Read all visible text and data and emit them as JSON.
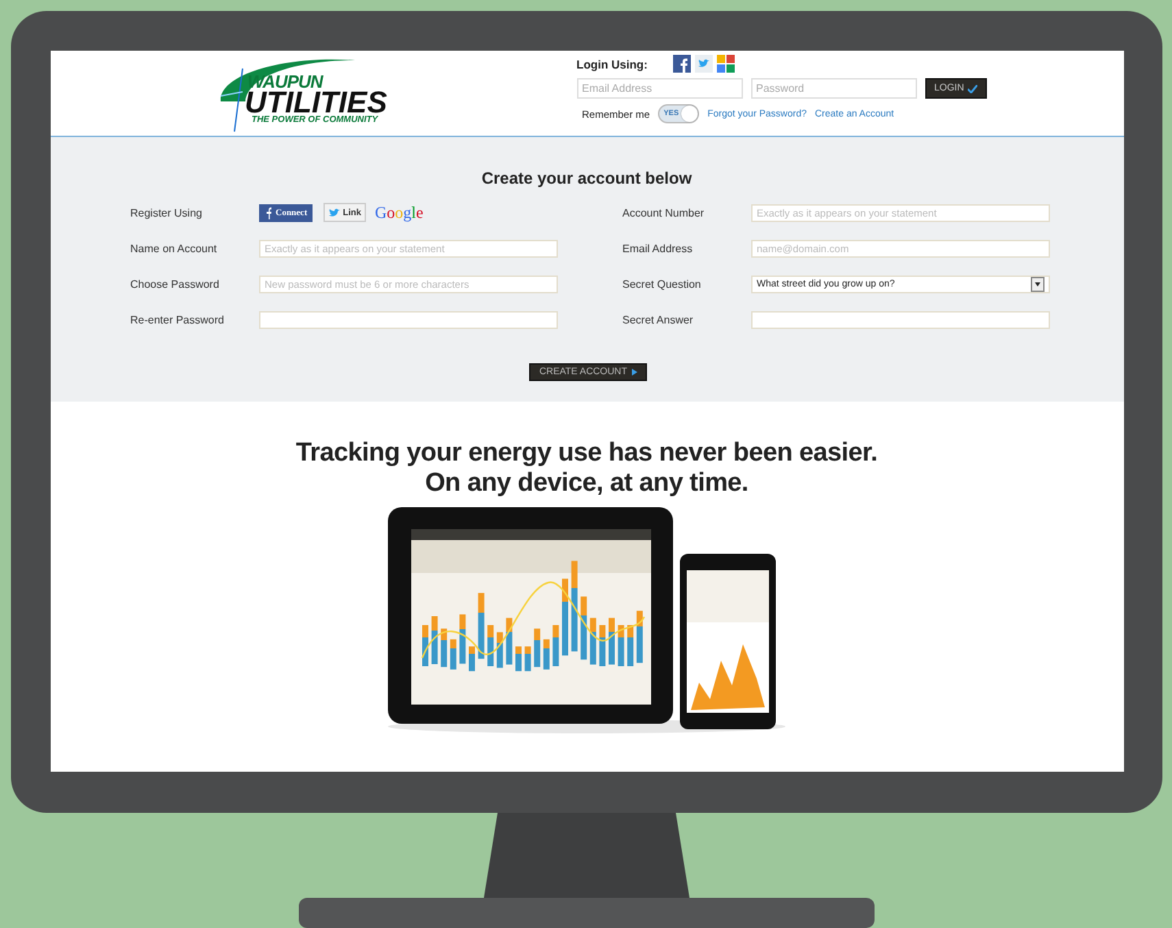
{
  "logo": {
    "name": "WAUPUN",
    "brand": "UTILITIES",
    "tagline": "THE POWER OF COMMUNITY"
  },
  "login": {
    "label": "Login Using:",
    "social": [
      {
        "kind": "facebook"
      },
      {
        "kind": "twitter"
      },
      {
        "kind": "google"
      }
    ],
    "email": {
      "placeholder": "Email Address"
    },
    "password": {
      "placeholder": "Password"
    },
    "button": "LOGIN",
    "remember": {
      "label": "Remember me",
      "toggle_text": "YES",
      "on": true
    },
    "links": [
      "Forgot your Password?",
      "Create an Account"
    ]
  },
  "register": {
    "title": "Create your account below",
    "social_label": "Register Using",
    "social_buttons": [
      {
        "kind": "facebook",
        "label": "Connect"
      },
      {
        "kind": "twitter",
        "label": "Link"
      },
      {
        "kind": "google",
        "label": "Google"
      }
    ],
    "left_fields": [
      {
        "label": "Name on Account",
        "placeholder": "Exactly as it appears on your statement"
      },
      {
        "label": "Choose Password",
        "placeholder": "New password must be 6 or more characters"
      },
      {
        "label": "Re-enter Password"
      }
    ],
    "right_fields": [
      {
        "kind": "text",
        "label": "Account Number",
        "placeholder": "Exactly as it appears on your statement"
      },
      {
        "kind": "text",
        "label": "Email Address",
        "placeholder": "name@domain.com"
      },
      {
        "kind": "select",
        "label": "Secret Question",
        "value": "What street did you grow up on?"
      },
      {
        "kind": "text",
        "label": "Secret Answer"
      }
    ],
    "button": "CREATE ACCOUNT"
  },
  "promo": {
    "headline": [
      "Tracking your energy use has never been easier.",
      "On any device, at any time."
    ],
    "picture": {
      "kind": "picture"
    }
  }
}
